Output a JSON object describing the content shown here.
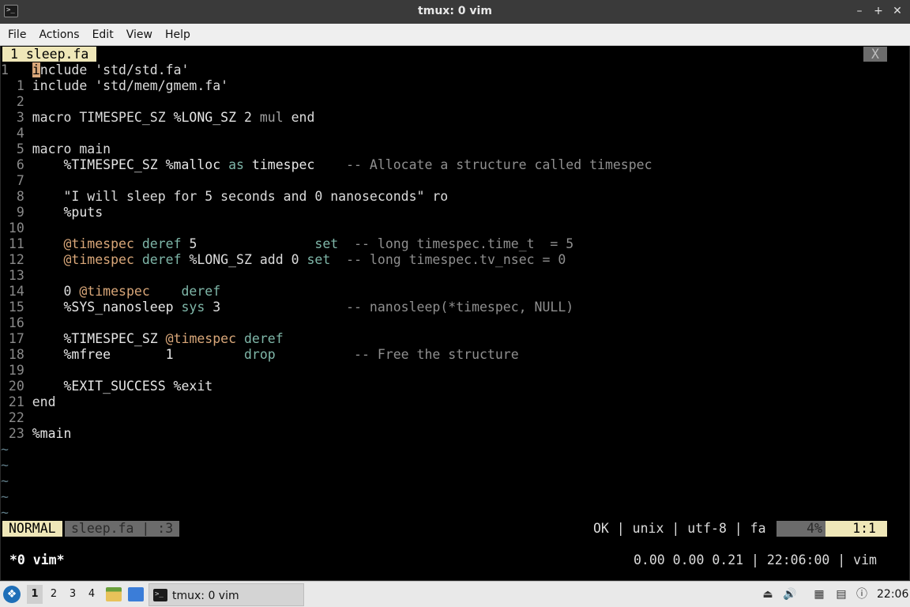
{
  "window": {
    "title": "tmux: 0 vim",
    "app_icon": ">_",
    "controls": [
      "–",
      "+",
      "✕"
    ]
  },
  "menubar": [
    "File",
    "Actions",
    "Edit",
    "View",
    "Help"
  ],
  "vim": {
    "tab_active": "1 sleep.fa",
    "tab_close": "X",
    "cursor_line_number": "1",
    "cursor_char": "i",
    "lines": [
      {
        "n": "",
        "segs": [
          {
            "t": "nclude 'std/std.fa'",
            "c": "kw"
          }
        ]
      },
      {
        "n": "1",
        "segs": [
          {
            "t": "include 'std/mem/gmem.fa'",
            "c": "kw"
          }
        ]
      },
      {
        "n": "2",
        "segs": []
      },
      {
        "n": "3",
        "segs": [
          {
            "t": "macro TIMESPEC_SZ ",
            "c": "kw"
          },
          {
            "t": "%LONG_SZ",
            "c": "fn"
          },
          {
            "t": " 2 ",
            "c": "kw"
          },
          {
            "t": "mul",
            "c": "op"
          },
          {
            "t": " end",
            "c": "kw"
          }
        ]
      },
      {
        "n": "4",
        "segs": []
      },
      {
        "n": "5",
        "segs": [
          {
            "t": "macro main",
            "c": "kw"
          }
        ]
      },
      {
        "n": "6",
        "segs": [
          {
            "t": "    %TIMESPEC_SZ %malloc ",
            "c": "fn"
          },
          {
            "t": "as",
            "c": "teal"
          },
          {
            "t": " timespec    ",
            "c": "fn"
          },
          {
            "t": "-- Allocate a structure called timespec",
            "c": "cm"
          }
        ]
      },
      {
        "n": "7",
        "segs": []
      },
      {
        "n": "8",
        "segs": [
          {
            "t": "    \"I will sleep for 5 seconds and 0 nanoseconds\" ro",
            "c": "str"
          }
        ]
      },
      {
        "n": "9",
        "segs": [
          {
            "t": "    %puts",
            "c": "fn"
          }
        ]
      },
      {
        "n": "10",
        "segs": []
      },
      {
        "n": "11",
        "segs": [
          {
            "t": "    ",
            "c": "kw"
          },
          {
            "t": "@timespec",
            "c": "var"
          },
          {
            "t": " deref",
            "c": "teal"
          },
          {
            "t": " 5               ",
            "c": "kw"
          },
          {
            "t": "set",
            "c": "teal"
          },
          {
            "t": "  -- long timespec.time_t  = 5",
            "c": "cm"
          }
        ]
      },
      {
        "n": "12",
        "segs": [
          {
            "t": "    ",
            "c": "kw"
          },
          {
            "t": "@timespec",
            "c": "var"
          },
          {
            "t": " deref",
            "c": "teal"
          },
          {
            "t": " %LONG_SZ add 0 ",
            "c": "kw"
          },
          {
            "t": "set",
            "c": "teal"
          },
          {
            "t": "  -- long timespec.tv_nsec = 0",
            "c": "cm"
          }
        ]
      },
      {
        "n": "13",
        "segs": []
      },
      {
        "n": "14",
        "segs": [
          {
            "t": "    0 ",
            "c": "kw"
          },
          {
            "t": "@timespec",
            "c": "var"
          },
          {
            "t": "    deref",
            "c": "teal"
          }
        ]
      },
      {
        "n": "15",
        "segs": [
          {
            "t": "    %SYS_nanosleep ",
            "c": "fn"
          },
          {
            "t": "sys",
            "c": "teal"
          },
          {
            "t": " 3                ",
            "c": "kw"
          },
          {
            "t": "-- nanosleep(*timespec, NULL)",
            "c": "cm"
          }
        ]
      },
      {
        "n": "16",
        "segs": []
      },
      {
        "n": "17",
        "segs": [
          {
            "t": "    %TIMESPEC_SZ ",
            "c": "fn"
          },
          {
            "t": "@timespec",
            "c": "var"
          },
          {
            "t": " deref",
            "c": "teal"
          }
        ]
      },
      {
        "n": "18",
        "segs": [
          {
            "t": "    %mfree       1         ",
            "c": "fn"
          },
          {
            "t": "drop",
            "c": "teal"
          },
          {
            "t": "          -- Free the structure",
            "c": "cm"
          }
        ]
      },
      {
        "n": "19",
        "segs": []
      },
      {
        "n": "20",
        "segs": [
          {
            "t": "    %EXIT_SUCCESS %exit",
            "c": "fn"
          }
        ]
      },
      {
        "n": "21",
        "segs": [
          {
            "t": "end",
            "c": "kw"
          }
        ]
      },
      {
        "n": "22",
        "segs": []
      },
      {
        "n": "23",
        "segs": [
          {
            "t": "%main",
            "c": "fn"
          }
        ]
      }
    ],
    "tilde_rows": 5,
    "status": {
      "mode": "NORMAL",
      "file": "sleep.fa | :3",
      "right": "OK | unix | utf-8 | fa",
      "percent": "4%",
      "position": "1:1"
    }
  },
  "tmux": {
    "window": "*0 vim*",
    "right": "0.00 0.00 0.21 | 22:06:00 | vim"
  },
  "taskbar": {
    "desktops": [
      "1",
      "2",
      "3",
      "4"
    ],
    "active_desktop": "1",
    "task_label": "tmux: 0 vim",
    "clock": "22:06"
  }
}
